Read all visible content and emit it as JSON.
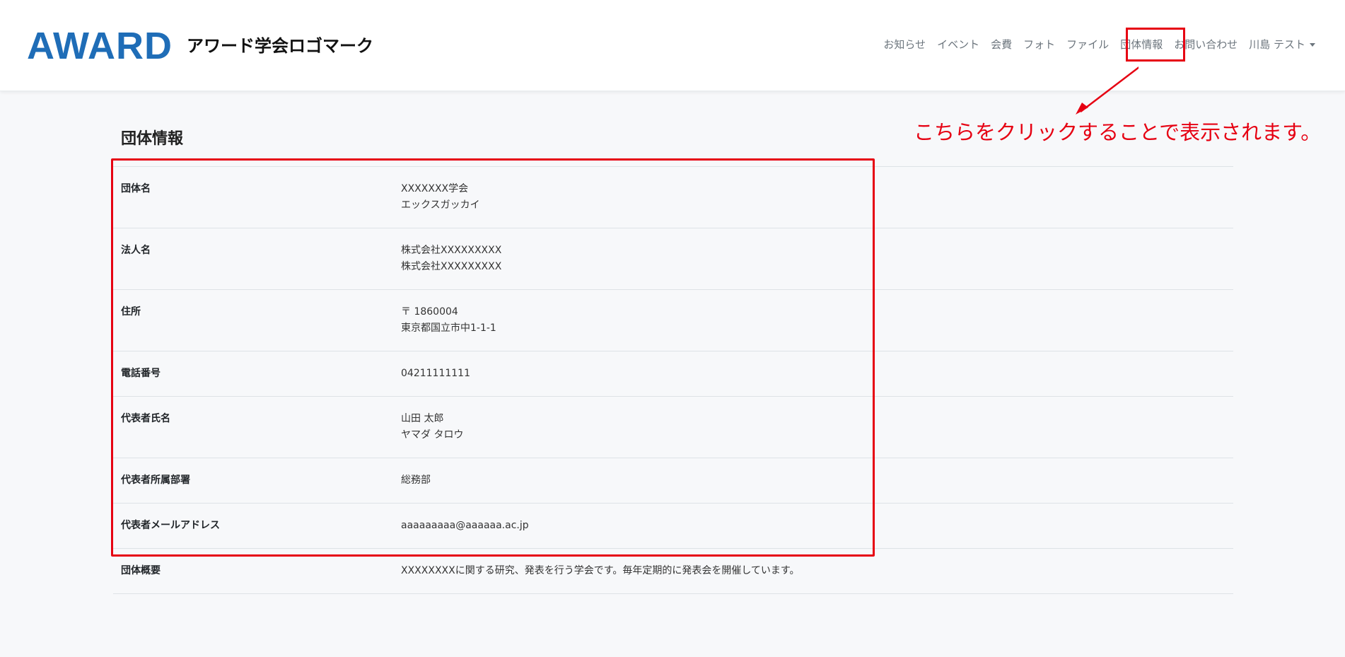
{
  "brand": {
    "logo": "AWARD",
    "name": "アワード学会ロゴマーク"
  },
  "nav": {
    "items": [
      "お知らせ",
      "イベント",
      "会費",
      "フォト",
      "ファイル",
      "団体情報",
      "お問い合わせ"
    ],
    "user": "川島 テスト"
  },
  "annotation": {
    "text": "こちらをクリックすることで表示されます。",
    "color": "#e60012"
  },
  "page": {
    "title": "団体情報"
  },
  "rows": [
    {
      "label": "団体名",
      "lines": [
        "XXXXXXX学会",
        "エックスガッカイ"
      ]
    },
    {
      "label": "法人名",
      "lines": [
        "株式会社XXXXXXXXX",
        "株式会社XXXXXXXXX"
      ]
    },
    {
      "label": "住所",
      "lines": [
        "〒 1860004",
        "東京都国立市中1-1-1"
      ]
    },
    {
      "label": "電話番号",
      "lines": [
        "04211111111"
      ]
    },
    {
      "label": "代表者氏名",
      "lines": [
        "山田 太郎",
        "ヤマダ タロウ"
      ]
    },
    {
      "label": "代表者所属部署",
      "lines": [
        "総務部"
      ]
    },
    {
      "label": "代表者メールアドレス",
      "lines": [
        "aaaaaaaaa@aaaaaa.ac.jp"
      ]
    },
    {
      "label": "団体概要",
      "lines": [
        "XXXXXXXXに関する研究、発表を行う学会です。毎年定期的に発表会を開催しています。"
      ]
    }
  ],
  "colors": {
    "brand": "#1f6db7",
    "highlight": "#e60012",
    "nav_text": "#6c757d"
  }
}
